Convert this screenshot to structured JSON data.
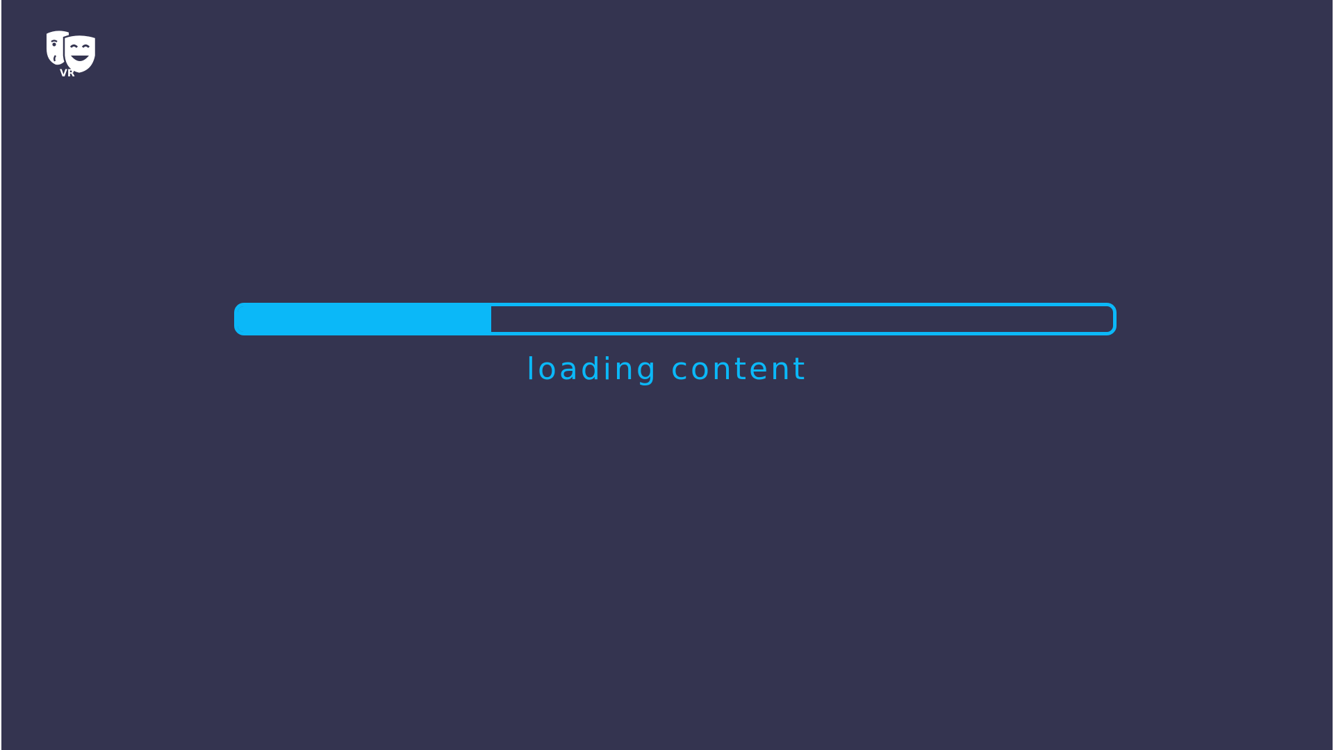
{
  "logo": {
    "icon": "theater-masks-icon",
    "text": "VR",
    "color": "#ffffff"
  },
  "progress": {
    "value": 0.29,
    "color": "#0bb8f8"
  },
  "status": {
    "text": "loading content"
  },
  "colors": {
    "background": "#343450",
    "accent": "#0bb8f8"
  }
}
